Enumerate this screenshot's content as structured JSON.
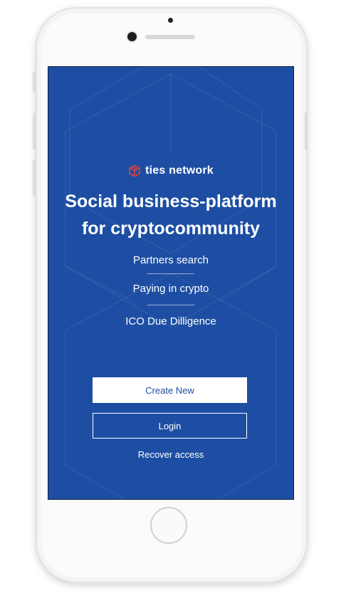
{
  "brand": {
    "name": "ties network",
    "accent_color": "#e0403a",
    "screen_color": "#1d4ea3"
  },
  "headline": {
    "line1": "Social business-platform",
    "line2": "for cryptocommunity"
  },
  "features": [
    "Partners search",
    "Paying in crypto",
    "ICO Due Dilligence"
  ],
  "actions": {
    "create_label": "Create New",
    "login_label": "Login",
    "recover_label": "Recover access"
  },
  "icons": {
    "logo": "ties-network-cube-icon"
  }
}
